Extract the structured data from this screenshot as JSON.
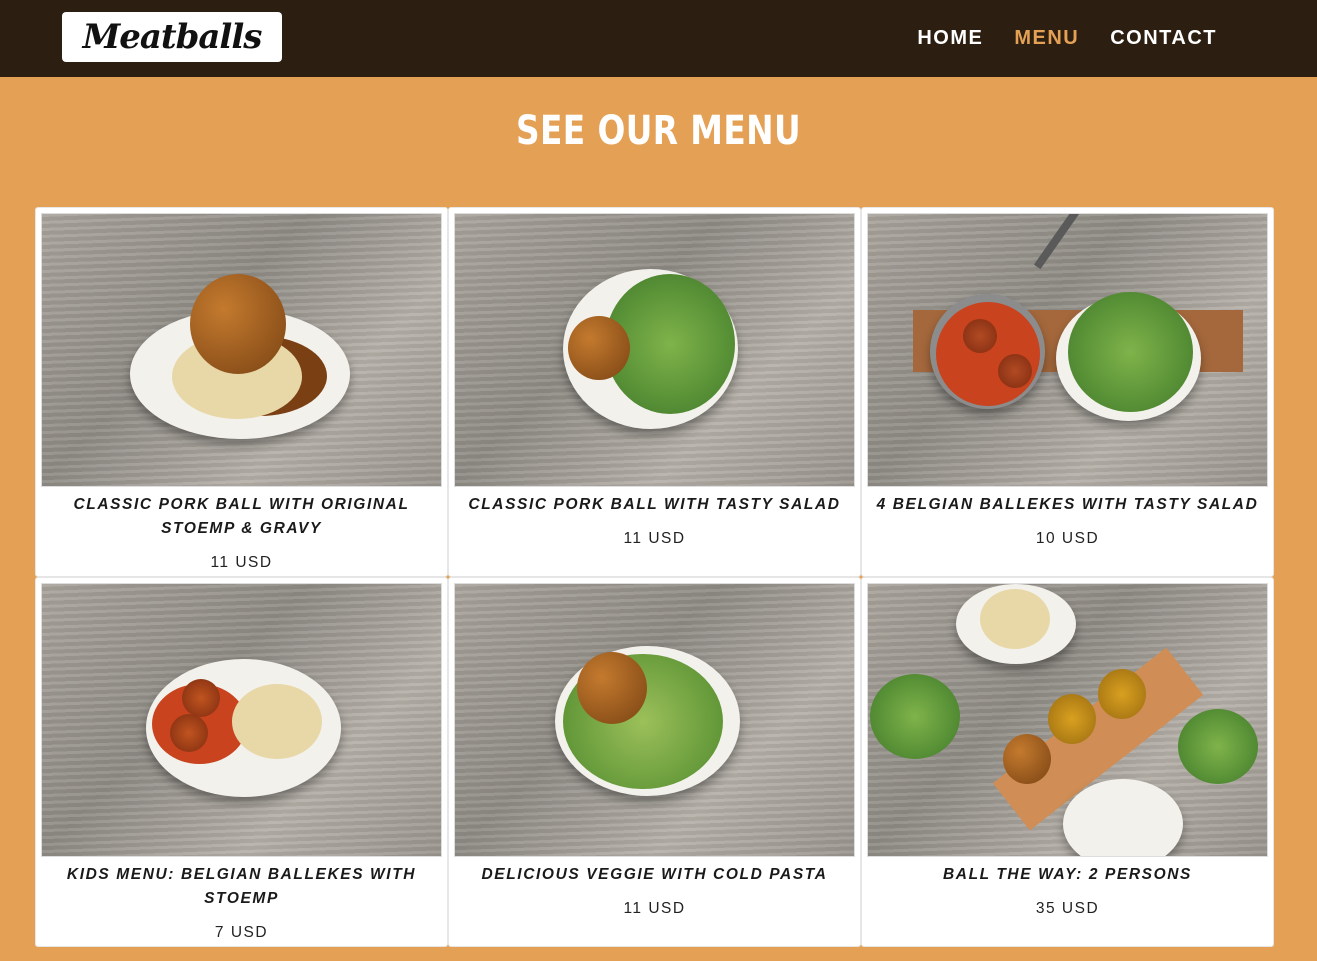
{
  "header": {
    "logo_text": "Meatballs",
    "nav": [
      {
        "label": "HOME",
        "active": false
      },
      {
        "label": "MENU",
        "active": true
      },
      {
        "label": "CONTACT",
        "active": false
      }
    ]
  },
  "main": {
    "title": "SEE OUR MENU",
    "items": [
      {
        "name": "CLASSIC PORK BALL WITH ORIGINAL STOEMP & GRAVY",
        "price": "11 USD"
      },
      {
        "name": "CLASSIC PORK BALL WITH TASTY SALAD",
        "price": "11 USD"
      },
      {
        "name": "4 BELGIAN BALLEKES WITH TASTY SALAD",
        "price": "10 USD"
      },
      {
        "name": "KIDS MENU: BELGIAN BALLEKES WITH STOEMP",
        "price": "7 USD"
      },
      {
        "name": "DELICIOUS VEGGIE WITH COLD PASTA",
        "price": "11 USD"
      },
      {
        "name": "BALL THE WAY: 2 PERSONS",
        "price": "35 USD"
      }
    ]
  },
  "colors": {
    "header_bg": "#2c1e10",
    "page_bg": "#e4a155",
    "accent": "#e4a155"
  }
}
